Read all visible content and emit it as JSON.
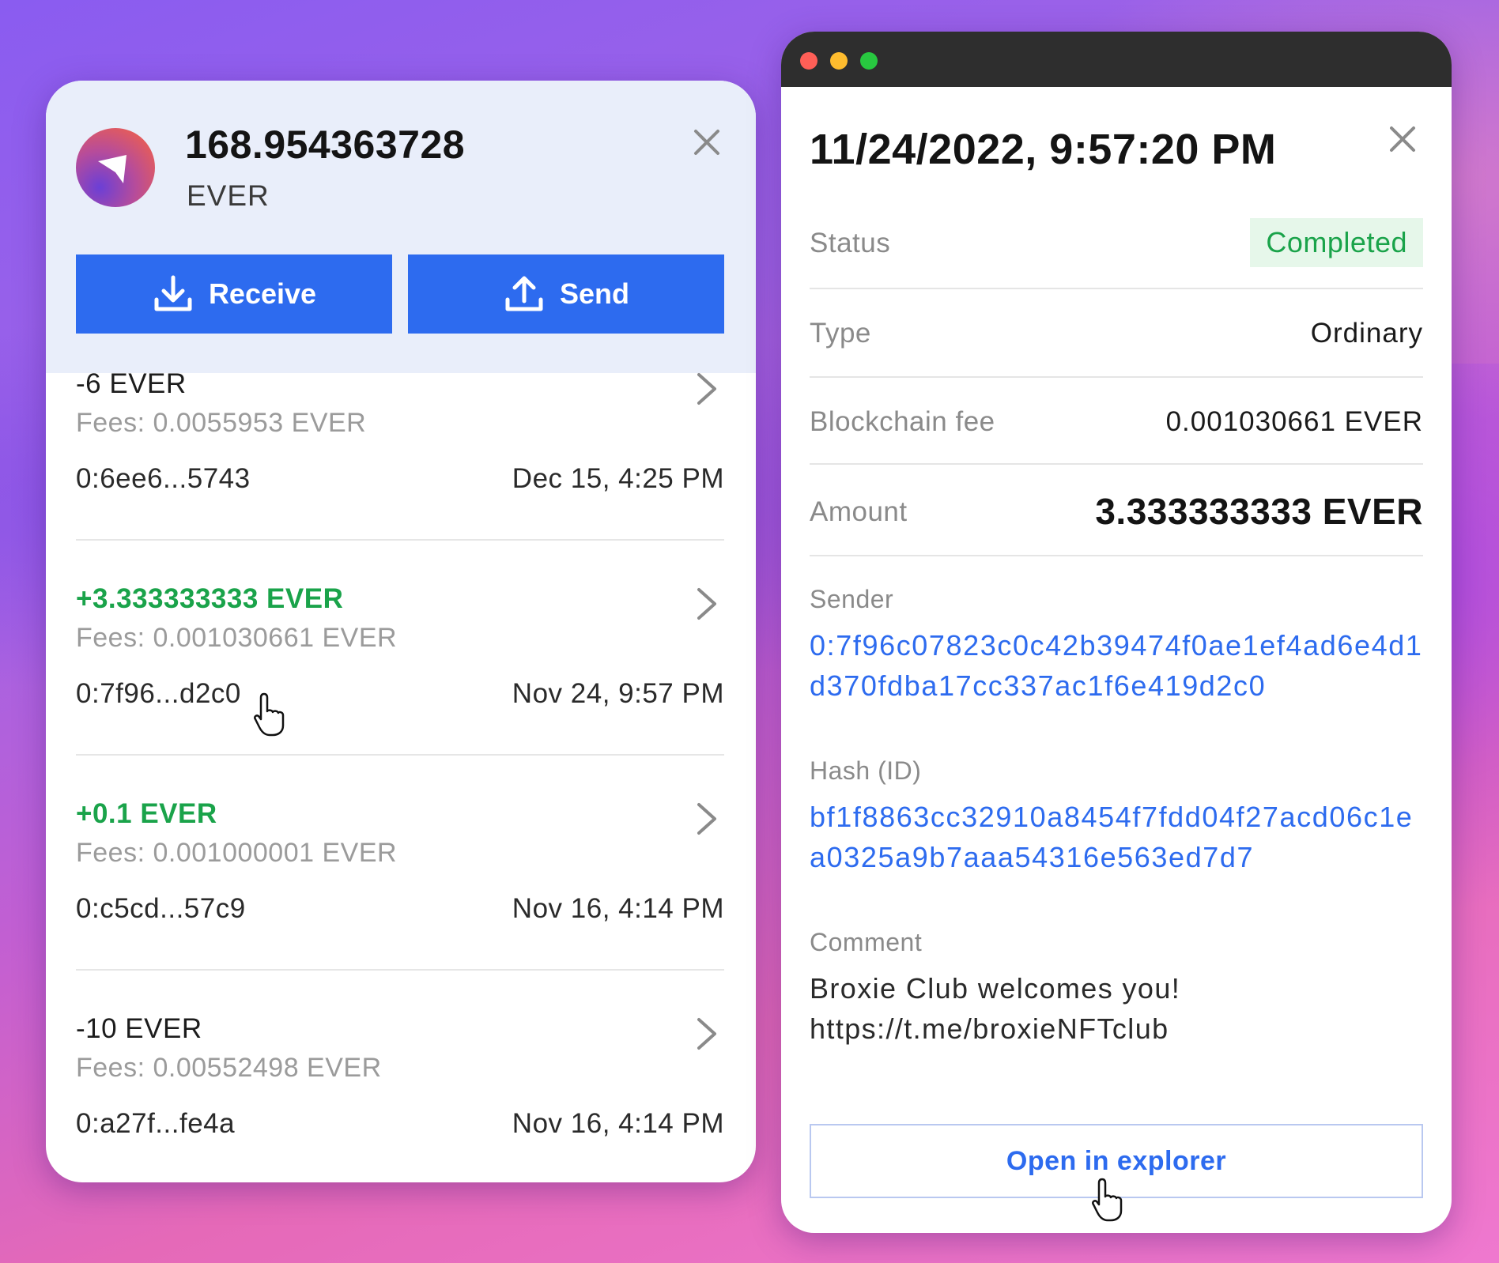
{
  "colors": {
    "accent": "#2d6bef",
    "positive": "#1aa34a",
    "muted": "#9b9b9b",
    "status_bg": "#e6f7ea"
  },
  "wallet": {
    "balance": "168.954363728",
    "ticker": "EVER",
    "close_icon": "close-icon",
    "receive_label": "Receive",
    "send_label": "Send",
    "transactions": [
      {
        "amount": "-6 EVER",
        "direction": "negative",
        "fees": "Fees: 0.0055953 EVER",
        "address": "0:6ee6...5743",
        "date": "Dec 15, 4:25 PM"
      },
      {
        "amount": "+3.333333333 EVER",
        "direction": "positive",
        "fees": "Fees: 0.001030661 EVER",
        "address": "0:7f96...d2c0",
        "date": "Nov 24, 9:57 PM"
      },
      {
        "amount": "+0.1 EVER",
        "direction": "positive",
        "fees": "Fees: 0.001000001 EVER",
        "address": "0:c5cd...57c9",
        "date": "Nov 16, 4:14 PM"
      },
      {
        "amount": "-10 EVER",
        "direction": "negative",
        "fees": "Fees: 0.00552498 EVER",
        "address": "0:a27f...fe4a",
        "date": "Nov 16, 4:14 PM"
      }
    ]
  },
  "details": {
    "title": "11/24/2022, 9:57:20 PM",
    "status_label": "Status",
    "status_value": "Completed",
    "type_label": "Type",
    "type_value": "Ordinary",
    "fee_label": "Blockchain fee",
    "fee_value": "0.001030661 EVER",
    "amount_label": "Amount",
    "amount_value": "3.333333333 EVER",
    "sender_label": "Sender",
    "sender_value": "0:7f96c07823c0c42b39474f0ae1ef4ad6e4d1d370fdba17cc337ac1f6e419d2c0",
    "hash_label": "Hash (ID)",
    "hash_value": "bf1f8863cc32910a8454f7fdd04f27acd06c1ea0325a9b7aaa54316e563ed7d7",
    "comment_label": "Comment",
    "comment_value": "Broxie Club welcomes you! https://t.me/broxieNFTclub",
    "explorer_label": "Open in explorer"
  }
}
